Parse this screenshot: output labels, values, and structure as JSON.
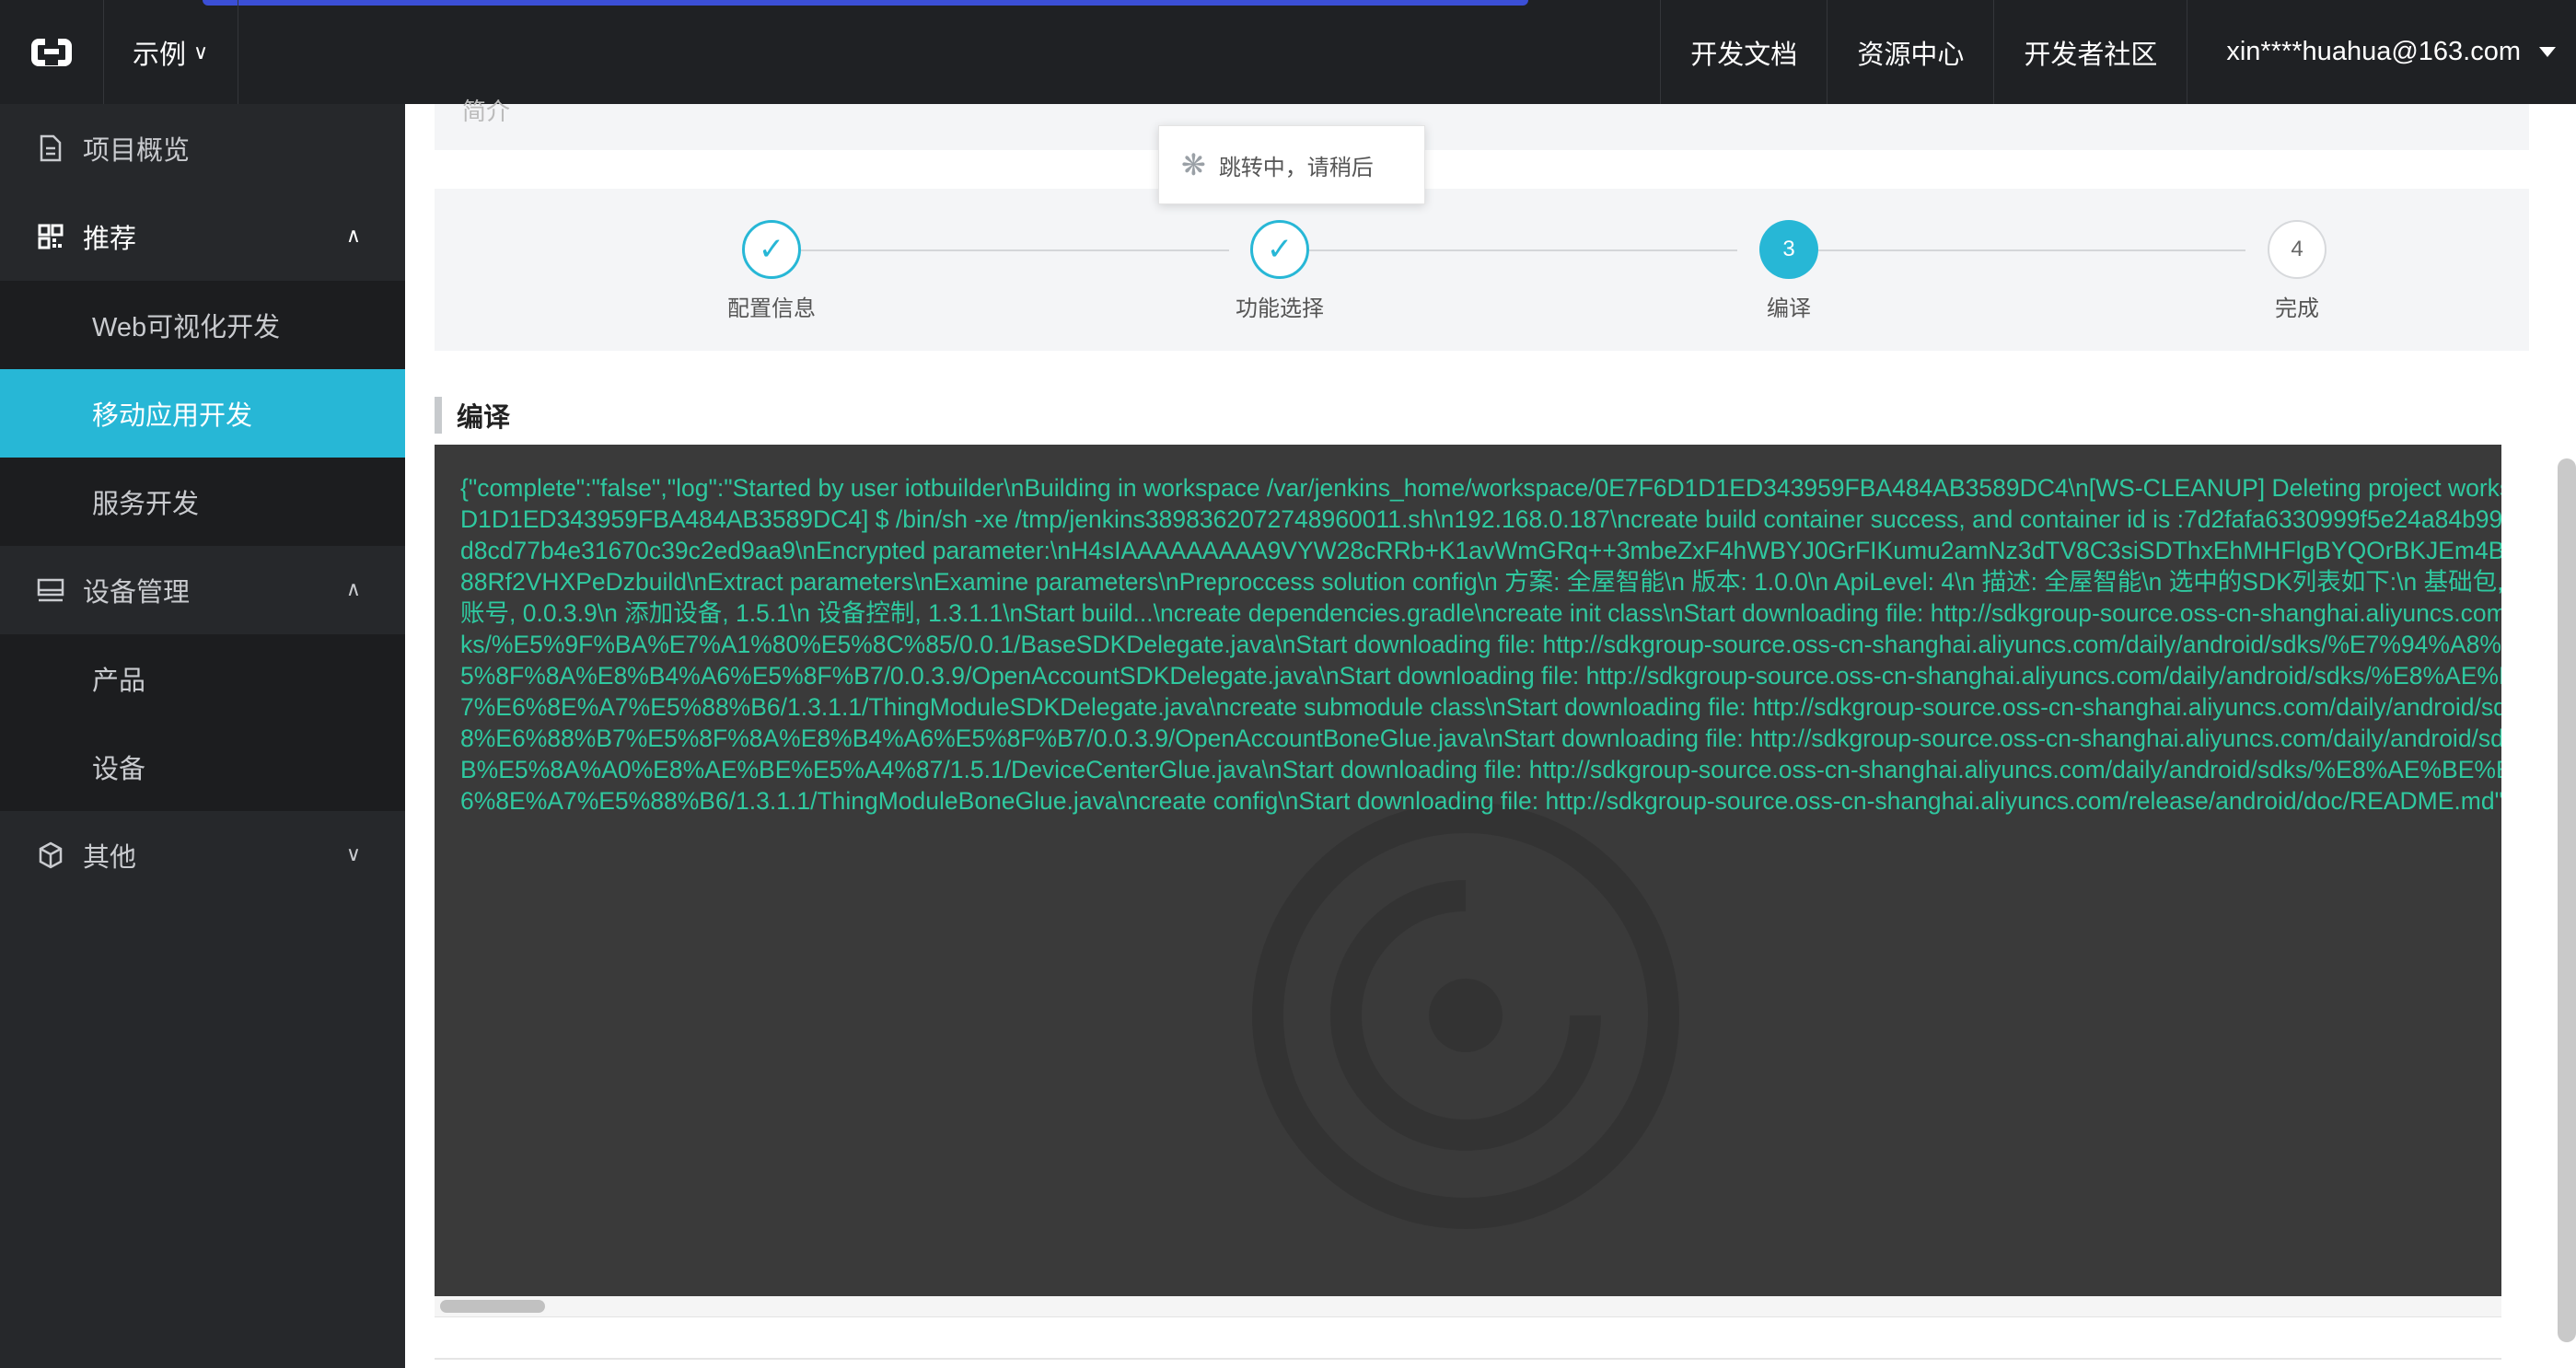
{
  "header": {
    "example_label": "示例",
    "nav": [
      "开发文档",
      "资源中心",
      "开发者社区"
    ],
    "user": "xin****huahua@163.com"
  },
  "sidebar": {
    "overview": "项目概览",
    "recommend": {
      "label": "推荐",
      "items": [
        "Web可视化开发",
        "移动应用开发",
        "服务开发"
      ],
      "active": "移动应用开发"
    },
    "devices": {
      "label": "设备管理",
      "items": [
        "产品",
        "设备"
      ]
    },
    "others": "其他"
  },
  "toast": {
    "text": "跳转中，请稍后"
  },
  "steps": [
    {
      "label": "配置信息",
      "state": "done",
      "num": ""
    },
    {
      "label": "功能选择",
      "state": "done",
      "num": ""
    },
    {
      "label": "编译",
      "state": "current",
      "num": "3"
    },
    {
      "label": "完成",
      "state": "todo",
      "num": "4"
    }
  ],
  "section_title": "编译",
  "log_text": "{\"complete\":\"false\",\"log\":\"Started by user iotbuilder\\nBuilding in workspace /var/jenkins_home/workspace/0E7F6D1D1ED343959FBA484AB3589DC4\\n[WS-CLEANUP] Deleting project workspace...\\n[0E7F6D1D1ED343959FBA484AB3589DC4] $ /bin/sh -xe /tmp/jenkins3898362072748960011.sh\\n192.168.0.187\\ncreate build container success, and container id is :7d2fafa6330999f5e24a84b9957df06b41bce27d8cd77b4e31670c39c2ed9aa9\\nEncrypted parameter:\\nH4sIAAAAAAAAA9VYW28cRRb+K1avWmGRq++3mbeZxF4hWBYJ0GrFIKumu2amNz3dTV8C3siSDThxEhMHFlgBYQOrBKJEm4BAyWLHyY/B3eM88Rf2VHXPeDzbuild\\nExtract parameters\\nExamine parameters\\nPreproccess solution config\\n 方案: 全屋智能\\n 版本: 1.0.0\\n ApiLevel: 4\\n 描述: 全屋智能\\n 选中的SDK列表如下:\\n 基础包, 0.0.1\\n 用户及账号, 0.0.3.9\\n 添加设备, 1.5.1\\n 设备控制, 1.3.1.1\\nStart build...\\ncreate dependencies.gradle\\ncreate init class\\nStart downloading file: http://sdkgroup-source.oss-cn-shanghai.aliyuncs.com/daily/android/sdks/%E5%9F%BA%E7%A1%80%E5%8C%85/0.0.1/BaseSDKDelegate.java\\nStart downloading file: http://sdkgroup-source.oss-cn-shanghai.aliyuncs.com/daily/android/sdks/%E7%94%A8%E6%88%B7%E5%8F%8A%E8%B4%A6%E5%8F%B7/0.0.3.9/OpenAccountSDKDelegate.java\\nStart downloading file: http://sdkgroup-source.oss-cn-shanghai.aliyuncs.com/daily/android/sdks/%E8%AE%BE%E5%A4%87%E6%8E%A7%E5%88%B6/1.3.1.1/ThingModuleSDKDelegate.java\\ncreate submodule class\\nStart downloading file: http://sdkgroup-source.oss-cn-shanghai.aliyuncs.com/daily/android/sdks/%E7%94%A8%E6%88%B7%E5%8F%8A%E8%B4%A6%E5%8F%B7/0.0.3.9/OpenAccountBoneGlue.java\\nStart downloading file: http://sdkgroup-source.oss-cn-shanghai.aliyuncs.com/daily/android/sdks/%E6%B7%BB%E5%8A%A0%E8%AE%BE%E5%A4%87/1.5.1/DeviceCenterGlue.java\\nStart downloading file: http://sdkgroup-source.oss-cn-shanghai.aliyuncs.com/daily/android/sdks/%E8%AE%BE%E5%A4%87%E6%8E%A7%E5%88%B6/1.3.1.1/ThingModuleBoneGlue.java\\ncreate config\\nStart downloading file: http://sdkgroup-source.oss-cn-shanghai.aliyuncs.com/release/android/doc/README.md\"}",
  "colors": {
    "accent": "#27b7d6",
    "log_text": "#2fc9a0",
    "console_bg": "#3a3a3a",
    "sidebar_bg": "#26282b",
    "topbar_bg": "#1f2124"
  },
  "icons": [
    "logo-icon",
    "document-icon",
    "grid-icon",
    "monitor-icon",
    "cube-icon",
    "chevron-down-icon",
    "chevron-up-icon",
    "check-icon",
    "spinner-icon"
  ]
}
